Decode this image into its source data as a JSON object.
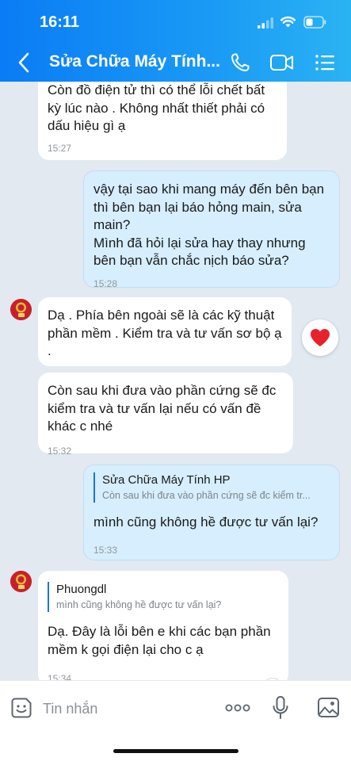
{
  "status_bar": {
    "time": "16:11"
  },
  "header": {
    "title": "Sửa Chữa Máy Tính..."
  },
  "messages": [
    {
      "text": "Còn đồ điện tử thì có thể lỗi chết bất kỳ lúc nào . Không nhất thiết phải có dấu hiệu gì  ạ",
      "time": "15:27"
    },
    {
      "text": "vậy tại sao khi mang máy đến bên bạn thì bên bạn lại báo hỏng main, sửa main?\nMình đã hỏi lại sửa hay thay nhưng bên bạn vẫn chắc nịch báo sửa?",
      "time": "15:28"
    },
    {
      "text": "Dạ . Phía bên ngoài sẽ là các kỹ thuật phần mềm .  Kiểm tra và tư vấn sơ bộ ạ ."
    },
    {
      "text": "Còn sau khi đưa vào phần cứng sẽ đc kiểm tra và tư vấn lại nếu có vấn đề khác c nhé",
      "time": "15:32"
    },
    {
      "quote_name": "Sửa Chữa Máy Tính HP",
      "quote_text": "Còn sau khi đưa vào phần cứng sẽ đc kiểm tr...",
      "text": "mình cũng không hề được tư vấn lại?",
      "time": "15:33"
    },
    {
      "quote_name": "Phuongdl",
      "quote_text": "mình cũng không hề được tư vấn lại?",
      "text": "Dạ. Đây là lỗi bên e khi các bạn phần mềm k gọi điện lại cho c ạ",
      "time": "15:34"
    }
  ],
  "reaction": {
    "icon": "heart-icon",
    "color": "#e8222c"
  },
  "input": {
    "placeholder": "Tin nhắn"
  },
  "colors": {
    "header_start": "#0a7cf5",
    "header_end": "#2ab3f3",
    "bubble_out": "#d6eefd",
    "bubble_in": "#ffffff",
    "background": "#e2e9f1"
  }
}
